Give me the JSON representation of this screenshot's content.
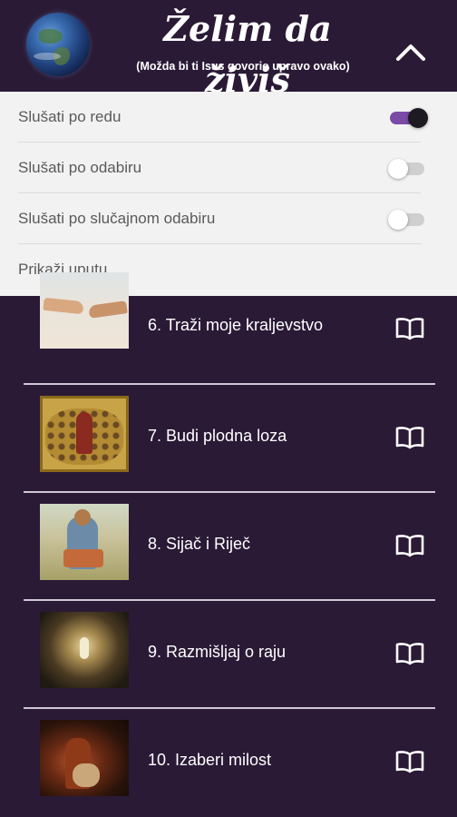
{
  "header": {
    "title": "Želim da živiš",
    "subtitle": "(Možda bi ti Isus govorio upravo ovako)"
  },
  "menu": {
    "items": [
      {
        "label": "Slušati po redu",
        "toggle": true
      },
      {
        "label": "Slušati po odabiru",
        "toggle": false
      },
      {
        "label": "Slušati po slučajnom odabiru",
        "toggle": false
      },
      {
        "label": "Prikaži uputu"
      }
    ]
  },
  "list": {
    "items": [
      {
        "title": "6. Traži moje kraljevstvo",
        "image": "creation-of-adam-painting"
      },
      {
        "title": "7. Budi plodna loza",
        "image": "vine-icon-painting"
      },
      {
        "title": "8. Sijač i Riječ",
        "image": "sower-painting"
      },
      {
        "title": "9. Razmišljaj o raju",
        "image": "paradise-painting"
      },
      {
        "title": "10. Izaberi milost",
        "image": "prodigal-son-painting"
      }
    ]
  },
  "colors": {
    "background": "#2a1a36",
    "menu_background": "#f2f2f2",
    "toggle_on": "#7a4aa6"
  },
  "icons": {
    "collapse": "chevron-up-icon",
    "read": "open-book-icon"
  }
}
